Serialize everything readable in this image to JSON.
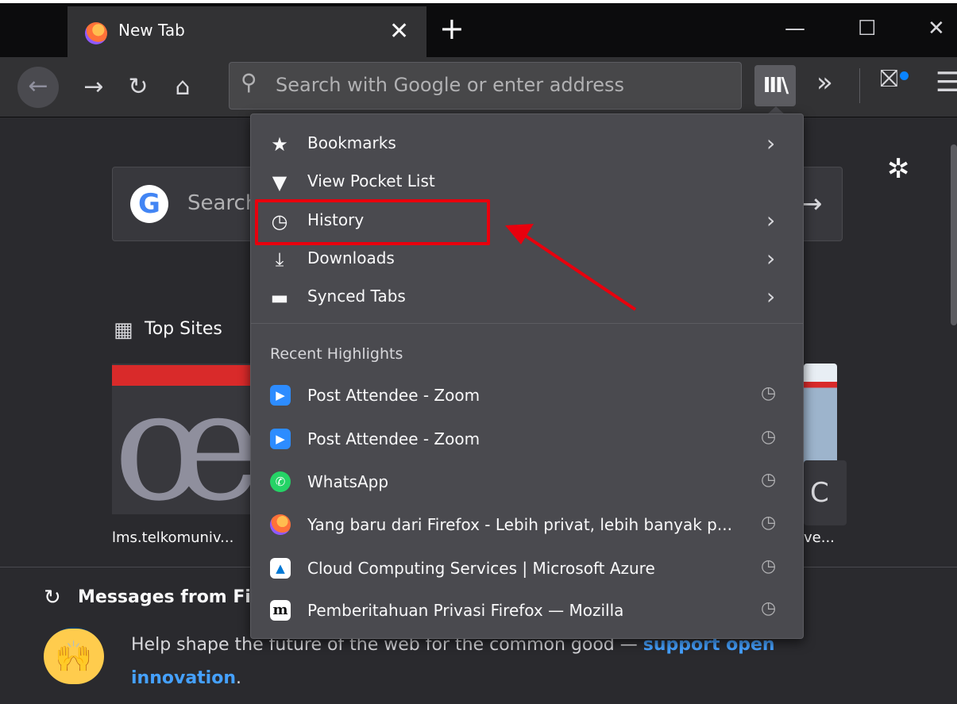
{
  "tab": {
    "title": "New Tab",
    "close_glyph": "✕"
  },
  "window": {
    "new_tab_glyph": "+",
    "minimize_glyph": "—",
    "maximize_glyph": "☐",
    "close_glyph": "✕"
  },
  "navbar": {
    "back_glyph": "←",
    "forward_glyph": "→",
    "reload_glyph": "↻",
    "home_glyph": "⌂",
    "search_icon_glyph": "⚲",
    "url_placeholder": "Search with Google or enter address",
    "library_glyph": "III\\",
    "overflow_glyph": "»",
    "gift_glyph": "⛝",
    "menu_glyph": "☰"
  },
  "newtab": {
    "settings_glyph": "✲",
    "search_text": "Search",
    "google_letter": "G",
    "search_arrow_glyph": "→",
    "top_sites_icon": "▦",
    "top_sites_label": "Top Sites",
    "tile1_logo": "œ",
    "tile1_label": "lms.telkomuniv...",
    "tile2_glyph": "C",
    "tile2_label": "ve...",
    "messages_icon": "↻",
    "messages_title": "Messages from Fi",
    "hands_glyph": "🙌",
    "message_text": "Help shape the future of the web for the common good — ",
    "message_link_part1": "support open",
    "message_link_part2": "innovation",
    "message_end": "."
  },
  "library_menu": {
    "items": [
      {
        "icon": "★",
        "label": "Bookmarks",
        "chevron": "›"
      },
      {
        "icon": "▼",
        "label": "View Pocket List",
        "chevron": ""
      },
      {
        "icon": "◷",
        "label": "History",
        "chevron": "›"
      },
      {
        "icon": "⤓",
        "label": "Downloads",
        "chevron": "›"
      },
      {
        "icon": "▬",
        "label": "Synced Tabs",
        "chevron": "›"
      }
    ],
    "section_title": "Recent Highlights",
    "highlights": [
      {
        "icon": "▶",
        "label": "Post Attendee - Zoom",
        "clock": "◷"
      },
      {
        "icon": "▶",
        "label": "Post Attendee - Zoom",
        "clock": "◷"
      },
      {
        "icon": "✆",
        "label": "WhatsApp",
        "clock": "◷"
      },
      {
        "icon": "●",
        "label": "Yang baru dari Firefox - Lebih privat, lebih banyak p...",
        "clock": "◷"
      },
      {
        "icon": "▲",
        "label": "Cloud Computing Services | Microsoft Azure",
        "clock": "◷"
      },
      {
        "icon": "m",
        "label": "Pemberitahuan Privasi Firefox — Mozilla",
        "clock": "◷"
      }
    ]
  },
  "colors": {
    "annotation_red": "#e8000d",
    "link_blue": "#45a1ff",
    "zoom_blue": "#2d8cff",
    "whatsapp_green": "#25d366",
    "azure_blue": "#0078d4"
  }
}
